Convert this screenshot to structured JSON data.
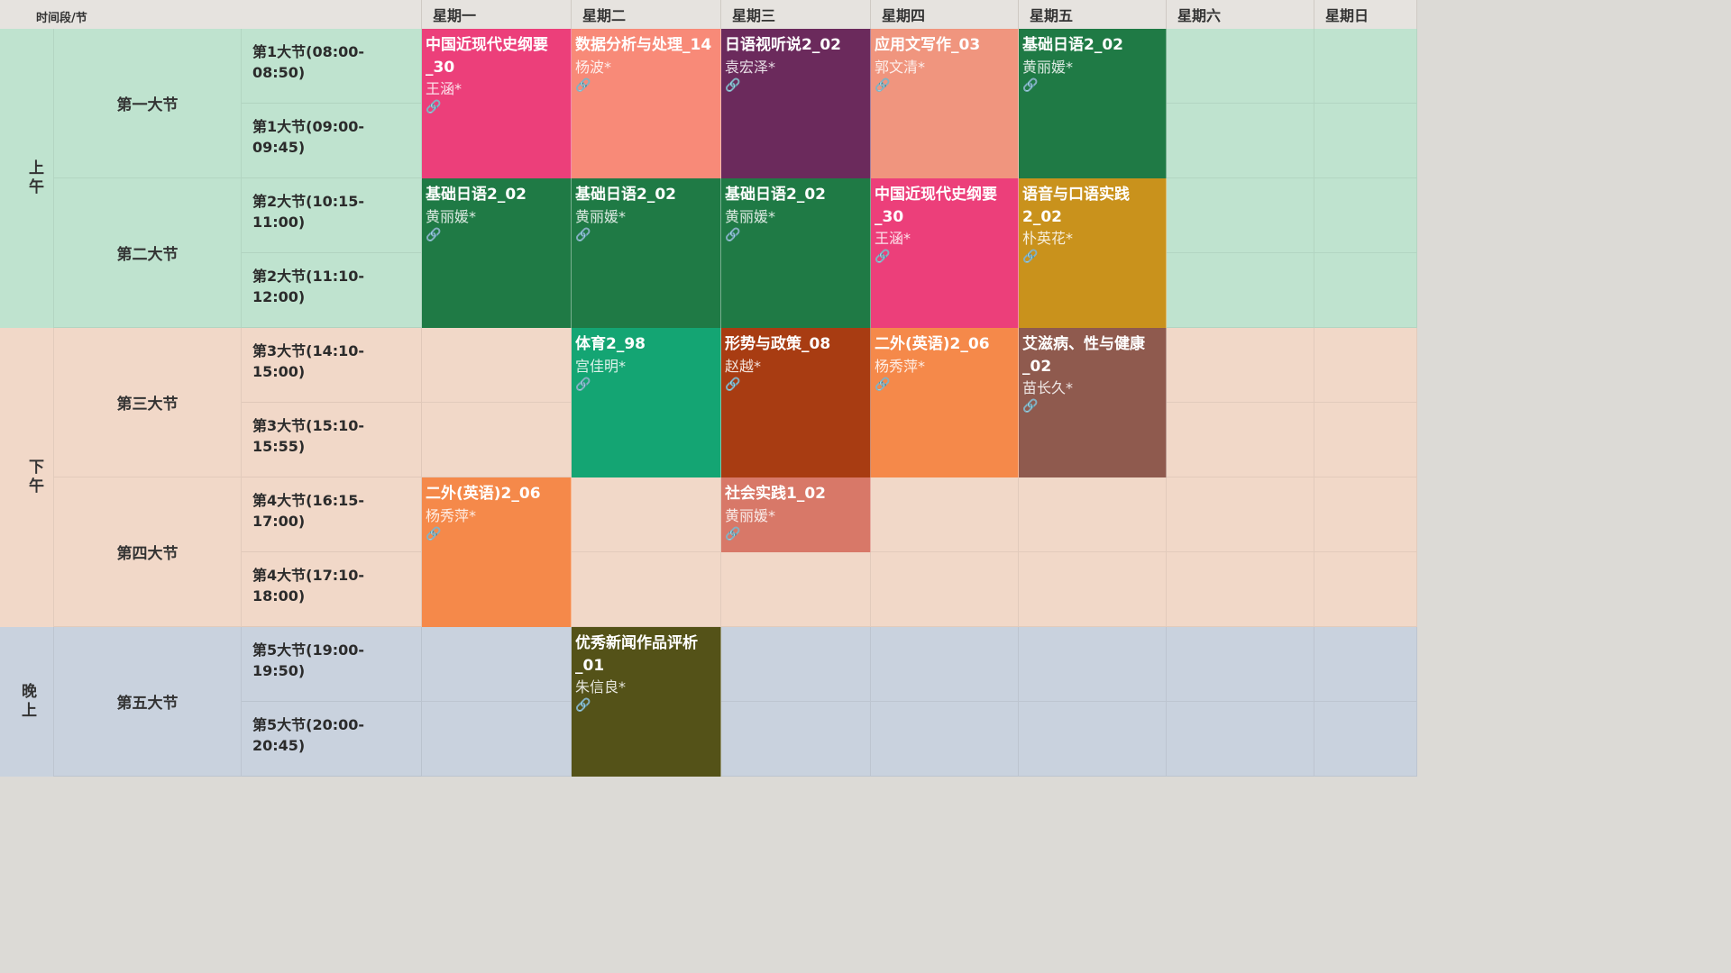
{
  "header": {
    "corner": "时间段/节",
    "days": [
      "星期一",
      "星期二",
      "星期三",
      "星期四",
      "星期五",
      "星期六",
      "星期日"
    ]
  },
  "periods": {
    "morning": "上午",
    "afternoon": "下午",
    "evening": "晚上"
  },
  "sections": [
    "第一大节",
    "第二大节",
    "第三大节",
    "第四大节",
    "第五大节"
  ],
  "slots": [
    "第1大节(08:00-\n08:50)",
    "第1大节(09:00-\n09:45)",
    "第2大节(10:15-\n11:00)",
    "第2大节(11:10-\n12:00)",
    "第3大节(14:10-\n15:00)",
    "第3大节(15:10-\n15:55)",
    "第4大节(16:15-\n17:00)",
    "第4大节(17:10-\n18:00)",
    "第5大节(19:00-\n19:50)",
    "第5大节(20:00-\n20:45)"
  ],
  "courses": [
    {
      "title": "中国近现代史纲要_30",
      "teacher": "王涵*",
      "day": 1,
      "section": 1,
      "color": "#ec3f7a"
    },
    {
      "title": "数据分析与处理_14",
      "teacher": "杨波*",
      "day": 2,
      "section": 1,
      "color": "#f88a78"
    },
    {
      "title": "日语视听说2_02",
      "teacher": "袁宏泽*",
      "day": 3,
      "section": 1,
      "color": "#6b2a5c"
    },
    {
      "title": "应用文写作_03",
      "teacher": "郭文清*",
      "day": 4,
      "section": 1,
      "color": "#f0957e"
    },
    {
      "title": "基础日语2_02",
      "teacher": "黄丽媛*",
      "day": 5,
      "section": 1,
      "color": "#1f7a45"
    },
    {
      "title": "基础日语2_02",
      "teacher": "黄丽媛*",
      "day": 1,
      "section": 2,
      "color": "#1f7a45"
    },
    {
      "title": "基础日语2_02",
      "teacher": "黄丽媛*",
      "day": 2,
      "section": 2,
      "color": "#1f7a45"
    },
    {
      "title": "基础日语2_02",
      "teacher": "黄丽媛*",
      "day": 3,
      "section": 2,
      "color": "#1f7a45"
    },
    {
      "title": "中国近现代史纲要_30",
      "teacher": "王涵*",
      "day": 4,
      "section": 2,
      "color": "#ec3f7a"
    },
    {
      "title": "语音与口语实践2_02",
      "teacher": "朴英花*",
      "day": 5,
      "section": 2,
      "color": "#c9921c"
    },
    {
      "title": "体育2_98",
      "teacher": "宫佳明*",
      "day": 2,
      "section": 3,
      "color": "#14a573"
    },
    {
      "title": "形势与政策_08",
      "teacher": "赵越*",
      "day": 3,
      "section": 3,
      "color": "#a83c12"
    },
    {
      "title": "二外(英语)2_06",
      "teacher": "杨秀萍*",
      "day": 4,
      "section": 3,
      "color": "#f5894a"
    },
    {
      "title": "艾滋病、性与健康_02",
      "teacher": "苗长久*",
      "day": 5,
      "section": 3,
      "color": "#8f5a4e"
    },
    {
      "title": "二外(英语)2_06",
      "teacher": "杨秀萍*",
      "day": 1,
      "section": 4,
      "color": "#f5894a"
    },
    {
      "title": "社会实践1_02",
      "teacher": "黄丽媛*",
      "day": 3,
      "section": 4,
      "color": "#d87868",
      "half": true
    },
    {
      "title": "优秀新闻作品评析_01",
      "teacher": "朱信良*",
      "day": 2,
      "section": 5,
      "color": "#545218"
    }
  ],
  "clip_icon": "🔗"
}
